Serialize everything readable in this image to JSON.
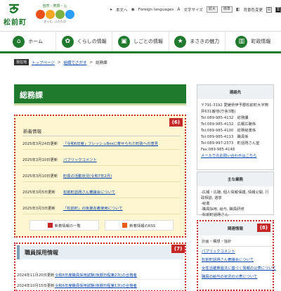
{
  "header": {
    "logo_text": "松前町",
    "sub_logo_top": "自然・笑顔・心",
    "sub_logo_bottom": "きっと、ふたたび",
    "sub_logo_colors": [
      "#e94e1b",
      "#f5a623",
      "#7cb342",
      "#2a9df4"
    ],
    "utility": {
      "home_label": "本文へ",
      "lang_label": "Foreign languages",
      "font_size_label": "文字サイズ",
      "enlarge_label": "拡大",
      "reset_label": "標準",
      "color_label": "背景色変更",
      "color_options": [
        "白",
        "黒",
        "青"
      ]
    }
  },
  "nav": {
    "items": [
      {
        "label": "ホーム",
        "icon": "home-icon",
        "glyph": "⌂"
      },
      {
        "label": "くらしの情報",
        "icon": "leaf-icon",
        "glyph": "✿"
      },
      {
        "label": "しごとの情報",
        "icon": "briefcase-icon",
        "glyph": "▣"
      },
      {
        "label": "まさきの魅力",
        "icon": "star-icon",
        "glyph": "★"
      },
      {
        "label": "町政情報",
        "icon": "building-icon",
        "glyph": "▥"
      }
    ]
  },
  "breadcrumb": {
    "badge": "現在地",
    "items": [
      "トップページ",
      "組織でさがす",
      "総務課"
    ]
  },
  "page": {
    "title": "総務課"
  },
  "news": {
    "title": "新着情報",
    "badge": "(6)",
    "rows": [
      {
        "date": "2025年3月24日更新",
        "text": "「令和6年度」フレッシュBoxに寄せられた町政への意見"
      },
      {
        "date": "2025年3月10日更新",
        "text": "パブリックコメント"
      },
      {
        "date": "2025年3月10日更新",
        "text": "町長の活動状況(令和7年2月)"
      },
      {
        "date": "2025年3月5日更新",
        "text": "松前町話題さん審議会について"
      },
      {
        "date": "2025年3月3日更新",
        "text": "「松前町」の後援名義使用について"
      }
    ],
    "list_button": "新着情報の一覧",
    "rss_button": "新着情報のRSS"
  },
  "jobs": {
    "title": "職員採用情報",
    "badge": "(7)",
    "rows": [
      {
        "date": "2024年11月20日更新",
        "text": "令和6年度職員採用試験(後期日程第2次)の合格者"
      },
      {
        "date": "2024年10月15日更新",
        "text": "令和6年度職員採用試験(後期日程第1次)の合格者"
      }
    ]
  },
  "contact": {
    "title": "連絡先",
    "lines": [
      "〒791-3192 愛媛県伊予郡松前町大字筒井631番地(庁舎3階)",
      "Tel:089-985-4132　総務課",
      "Tel:089-985-4132　広報広聴係",
      "Tel:089-985-4100　総務秘書係",
      "Tel:089-985-4113　職員係",
      "Tel:089-997-2373　町話題さん室",
      "Fax:089-985-4148"
    ],
    "mail_link": "メールでのお問い合わせはこちら"
  },
  "duties": {
    "title": "主な業務",
    "lines": [
      "-広報・広聴, 個人情報保護, 情報公開, 行政相談, 選挙",
      "-秘書",
      "-職員採用, 給与, 職員研修",
      "-松前町話題さん"
    ]
  },
  "related": {
    "title": "関連情報",
    "badge": "(8)",
    "subtitle": "計画・構想・指針",
    "items": [
      "パブリックコメント",
      "松前町話題さん審議会について",
      "女性活躍推進法に基づく情報の公表について",
      "職員の給与の状況の公表について"
    ]
  }
}
